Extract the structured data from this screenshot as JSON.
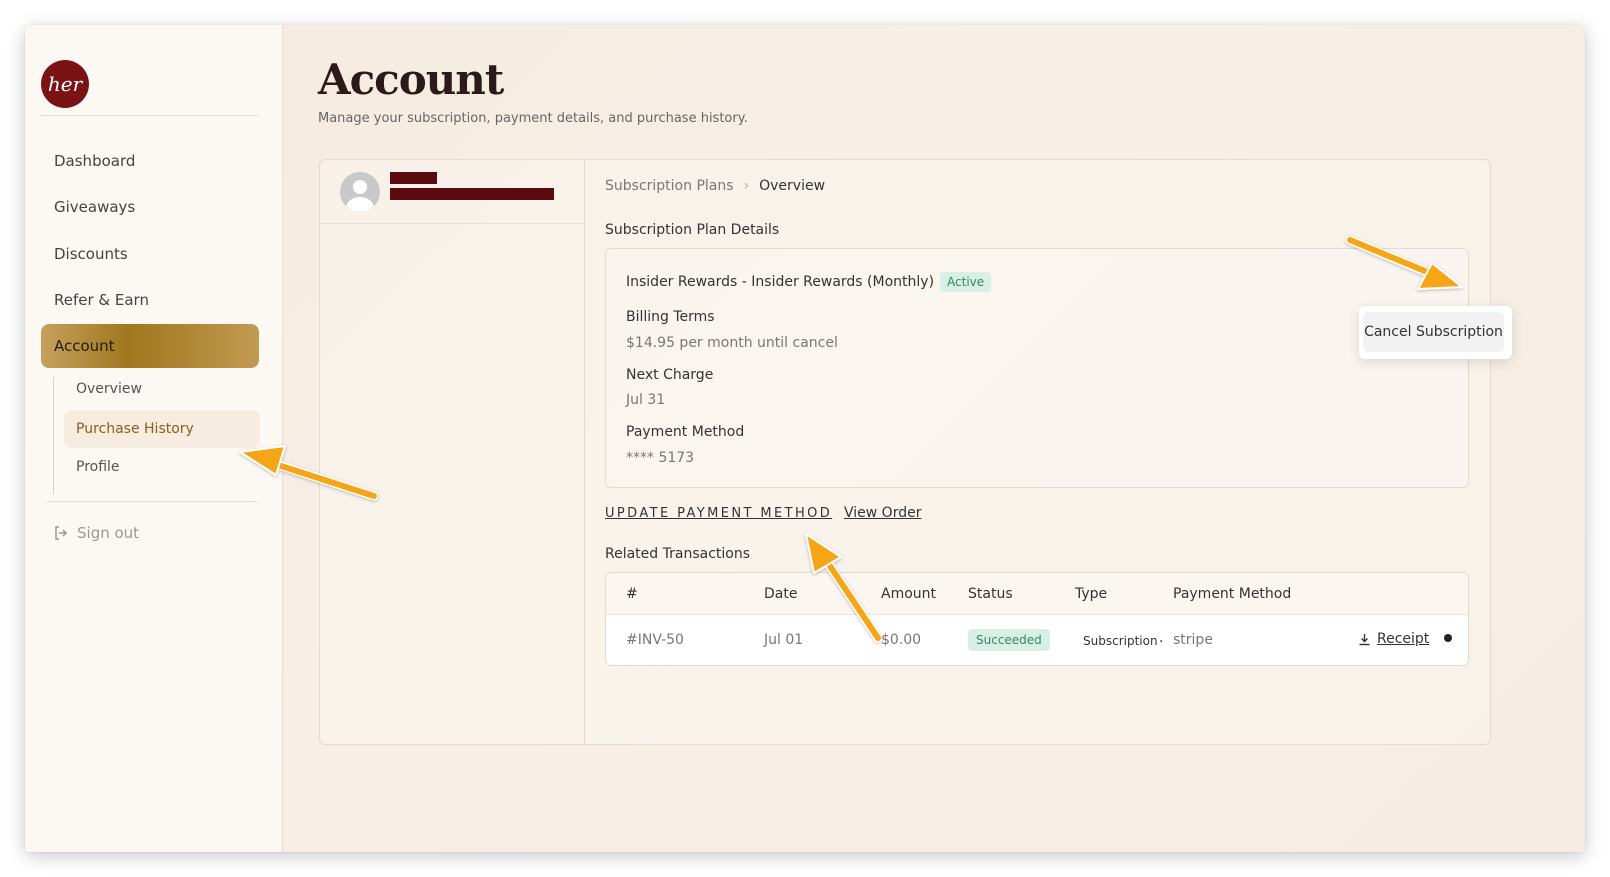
{
  "brand": {
    "logo_text": "her"
  },
  "sidebar": {
    "items": [
      {
        "label": "Dashboard"
      },
      {
        "label": "Giveaways"
      },
      {
        "label": "Discounts"
      },
      {
        "label": "Refer & Earn"
      },
      {
        "label": "Account"
      }
    ],
    "sub_items": [
      {
        "label": "Overview"
      },
      {
        "label": "Purchase History"
      },
      {
        "label": "Profile"
      }
    ],
    "sign_out": "Sign out"
  },
  "page": {
    "title": "Account",
    "subtitle": "Manage your subscription, payment details, and purchase history."
  },
  "breadcrumb": {
    "parent": "Subscription Plans",
    "separator": "›",
    "current": "Overview"
  },
  "plan": {
    "section_title": "Subscription Plan Details",
    "name": "Insider Rewards - Insider Rewards (Monthly)",
    "status": "Active",
    "billing_label": "Billing Terms",
    "billing_value": "$14.95 per month until cancel",
    "next_charge_label": "Next Charge",
    "next_charge_value": "Jul 31",
    "payment_label": "Payment Method",
    "payment_value": "**** 5173",
    "menu_icon": "⋮"
  },
  "menu": {
    "cancel_label": "Cancel Subscription"
  },
  "actions": {
    "update_payment": "UPDATE PAYMENT METHOD",
    "view_order": "View Order"
  },
  "transactions": {
    "title": "Related Transactions",
    "headers": [
      "#",
      "Date",
      "Amount",
      "Status",
      "Type",
      "Payment Method"
    ],
    "rows": [
      {
        "id": "#INV-50",
        "date": "Jul 01",
        "amount": "$0.00",
        "status": "Succeeded",
        "type": "Subscription",
        "type_sep": ".",
        "method": "stripe",
        "receipt": "Receipt"
      }
    ]
  },
  "colors": {
    "accent": "#a0761e",
    "brand": "#7a1216",
    "success_bg": "#d9efe6",
    "success_text": "#2f8a6a",
    "arrow": "#f5a514"
  }
}
